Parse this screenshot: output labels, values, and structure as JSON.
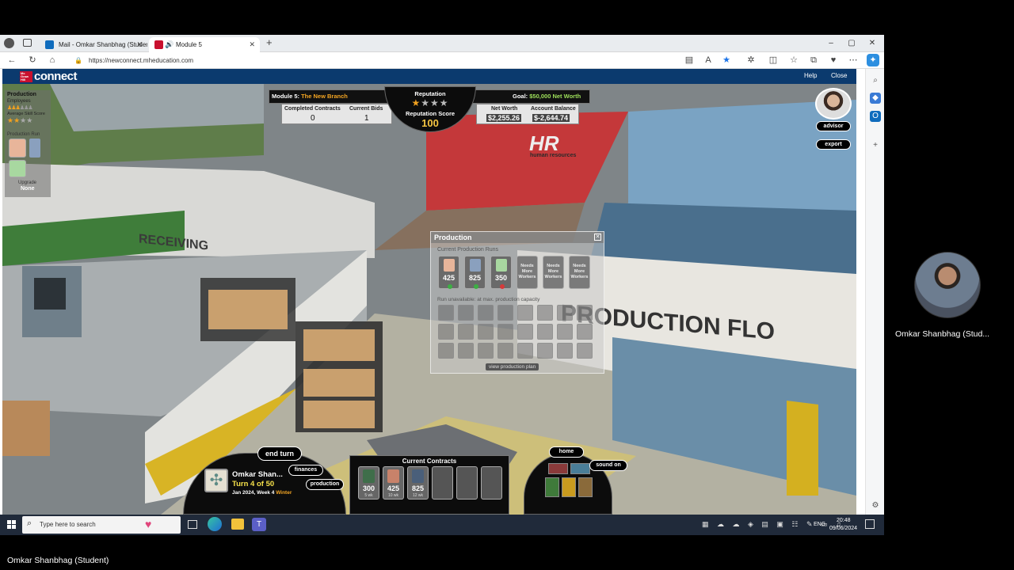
{
  "browser": {
    "tabs": [
      {
        "label": "Mail - Omkar Shanbhag (Studen",
        "icon": "outlook-icon"
      },
      {
        "label": "Module 5",
        "icon": "mcgraw-hill-icon",
        "audio": true
      }
    ],
    "url": "https://newconnect.mheducation.com"
  },
  "site": {
    "logo_small": "Mc Graw Hill",
    "logo_text": "connect",
    "help": "Help",
    "close": "Close"
  },
  "hud": {
    "module_prefix": "Module 5:",
    "module_name": "The New Branch",
    "completed_contracts_label": "Completed Contracts",
    "completed_contracts": "0",
    "current_bids_label": "Current Bids",
    "current_bids": "1",
    "reputation_label": "Reputation",
    "reputation_stars_filled": 1,
    "reputation_stars_total": 4,
    "reputation_score_label": "Reputation Score",
    "reputation_score": "100",
    "goal_label": "Goal:",
    "goal_value": "$50,000 Net Worth",
    "net_worth_label": "Net Worth",
    "net_worth": "$2,255.26",
    "account_balance_label": "Account Balance",
    "account_balance": "$-2,644.74",
    "advisor": "advisor",
    "export": "export"
  },
  "left_panel": {
    "title": "Production",
    "employees_label": "Employees",
    "avg_skill_label": "Average Skill Score",
    "production_run_label": "Production Run",
    "upgrade_label": "Upgrade",
    "upgrade_value": "None"
  },
  "scene_signs": {
    "hr_title": "HR",
    "hr_sub": "human resources",
    "receiving": "RECEIVING",
    "production_floor": "PRODUCTION FLO"
  },
  "production_popup": {
    "title": "Production",
    "current_runs_label": "Current Production Runs",
    "runs": [
      {
        "value": "425",
        "kind": "sweater"
      },
      {
        "value": "825",
        "kind": "pants"
      },
      {
        "value": "350",
        "kind": "shirt"
      }
    ],
    "needs": [
      "Needs More Workers",
      "Needs More Workers",
      "Needs More Workers"
    ],
    "unavailable_label": "Run unavailable: at max. production capacity",
    "view_plan": "view production plan"
  },
  "bottom": {
    "end_turn": "end turn",
    "finances": "finances",
    "production": "production",
    "player_name": "Omkar Shan...",
    "turn": "Turn 4 of 50",
    "date_text": "Jan 2024, Week 4",
    "season": "Winter",
    "contracts_title": "Current Contracts",
    "contracts": [
      {
        "value": "300",
        "weeks": "5 wk",
        "color": "#3f6e4a"
      },
      {
        "value": "425",
        "weeks": "10 wk",
        "color": "#c8826a"
      },
      {
        "value": "825",
        "weeks": "12 wk",
        "color": "#4a5f7a"
      }
    ],
    "home": "home",
    "sound_on": "sound on",
    "swatches_top": [
      "#8a3a3a",
      "#4a7e98"
    ],
    "swatches_bottom": [
      "#3f7a3a",
      "#c99b1f",
      "#8a6a3a"
    ]
  },
  "taskbar": {
    "search_placeholder": "Type here to search",
    "lang": "ENG",
    "time": "20:48",
    "date": "09/06/2024"
  },
  "meeting": {
    "participant": "Omkar Shanbhag (Stud...",
    "footer_name": "Omkar Shanbhag (Student)"
  }
}
